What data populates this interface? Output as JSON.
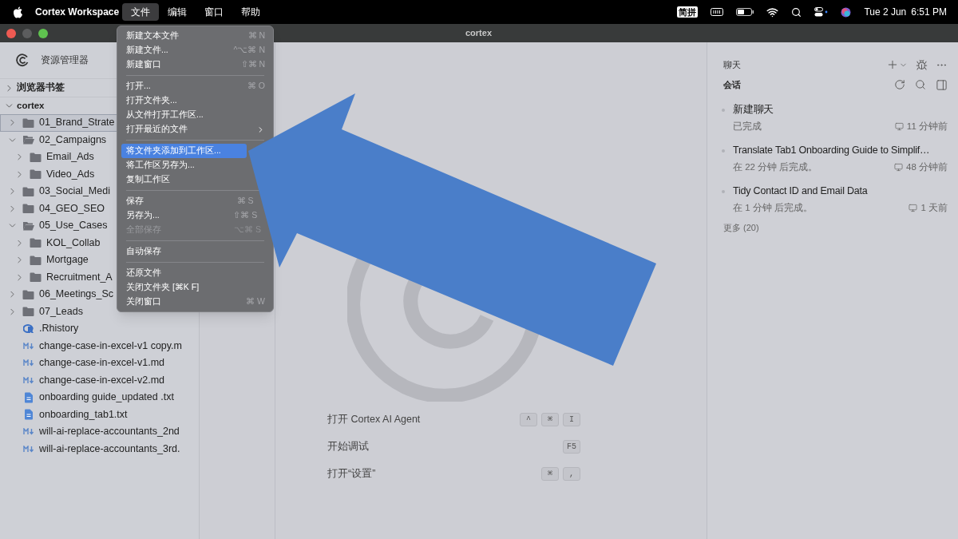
{
  "menubar": {
    "app_name": "Cortex Workspace",
    "menus": [
      {
        "label": "文件",
        "selected": true
      },
      {
        "label": "编辑",
        "selected": false
      },
      {
        "label": "窗口",
        "selected": false
      },
      {
        "label": "帮助",
        "selected": false
      }
    ],
    "input_method": "简拼",
    "date": "Tue 2 Jun",
    "time": "6:51 PM"
  },
  "window": {
    "title": "cortex"
  },
  "explorer": {
    "title": "资源管理器",
    "sections": [
      {
        "label": "浏览器书签",
        "expanded": false
      },
      {
        "label": "cortex",
        "expanded": true,
        "children": [
          {
            "name": "01_Brand_Strate",
            "kind": "folder",
            "expanded": false,
            "selected": true
          },
          {
            "name": "02_Campaigns",
            "kind": "folder",
            "expanded": true,
            "selected": false,
            "children": [
              {
                "name": "Email_Ads",
                "kind": "folder",
                "expanded": false,
                "selected": false
              },
              {
                "name": "Video_Ads",
                "kind": "folder",
                "expanded": false,
                "selected": false
              }
            ]
          },
          {
            "name": "03_Social_Medi",
            "kind": "folder",
            "expanded": false,
            "selected": false
          },
          {
            "name": "04_GEO_SEO",
            "kind": "folder",
            "expanded": false,
            "selected": false
          },
          {
            "name": "05_Use_Cases",
            "kind": "folder",
            "expanded": true,
            "selected": false,
            "children": [
              {
                "name": "KOL_Collab",
                "kind": "folder",
                "expanded": false,
                "selected": false
              },
              {
                "name": "Mortgage",
                "kind": "folder",
                "expanded": false,
                "selected": false
              },
              {
                "name": "Recruitment_A",
                "kind": "folder",
                "expanded": false,
                "selected": false
              }
            ]
          },
          {
            "name": "06_Meetings_Sc",
            "kind": "folder",
            "expanded": false,
            "selected": false
          },
          {
            "name": "07_Leads",
            "kind": "folder",
            "expanded": false,
            "selected": false
          },
          {
            "name": ".Rhistory",
            "kind": "r",
            "selected": false
          },
          {
            "name": "change-case-in-excel-v1 copy.m",
            "kind": "md",
            "selected": false
          },
          {
            "name": "change-case-in-excel-v1.md",
            "kind": "md",
            "selected": false
          },
          {
            "name": "change-case-in-excel-v2.md",
            "kind": "md",
            "selected": false
          },
          {
            "name": "onboarding guide_updated .txt",
            "kind": "txt",
            "selected": false
          },
          {
            "name": "onboarding_tab1.txt",
            "kind": "txt",
            "selected": false
          },
          {
            "name": "will-ai-replace-accountants_2nd",
            "kind": "md",
            "selected": false
          },
          {
            "name": "will-ai-replace-accountants_3rd.",
            "kind": "md",
            "selected": false
          }
        ]
      }
    ]
  },
  "file_menu": {
    "items": [
      {
        "kind": "item",
        "label": "新建文本文件",
        "shortcut": "⌘ N",
        "disabled": false,
        "selected": false
      },
      {
        "kind": "item",
        "label": "新建文件...",
        "shortcut": "^⌥⌘ N",
        "disabled": false,
        "selected": false
      },
      {
        "kind": "item",
        "label": "新建窗口",
        "shortcut": "⇧⌘ N",
        "disabled": false,
        "selected": false
      },
      {
        "kind": "separator"
      },
      {
        "kind": "item",
        "label": "打开...",
        "shortcut": "⌘ O",
        "disabled": false,
        "selected": false
      },
      {
        "kind": "item",
        "label": "打开文件夹...",
        "disabled": false,
        "selected": false
      },
      {
        "kind": "item",
        "label": "从文件打开工作区...",
        "disabled": false,
        "selected": false
      },
      {
        "kind": "item",
        "label": "打开最近的文件",
        "submenu": true,
        "disabled": false,
        "selected": false
      },
      {
        "kind": "separator"
      },
      {
        "kind": "item",
        "label": "将文件夹添加到工作区...",
        "disabled": false,
        "selected": true
      },
      {
        "kind": "item",
        "label": "将工作区另存为...",
        "disabled": false,
        "selected": false
      },
      {
        "kind": "item",
        "label": "复制工作区",
        "disabled": false,
        "selected": false
      },
      {
        "kind": "separator"
      },
      {
        "kind": "item",
        "label": "保存",
        "shortcut": "⌘ S",
        "disabled": false,
        "selected": false
      },
      {
        "kind": "item",
        "label": "另存为...",
        "shortcut": "⇧⌘ S",
        "disabled": false,
        "selected": false
      },
      {
        "kind": "item",
        "label": "全部保存",
        "shortcut": "⌥⌘ S",
        "disabled": true,
        "selected": false
      },
      {
        "kind": "separator"
      },
      {
        "kind": "item",
        "label": "自动保存",
        "disabled": false,
        "selected": false
      },
      {
        "kind": "separator"
      },
      {
        "kind": "item",
        "label": "还原文件",
        "disabled": false,
        "selected": false
      },
      {
        "kind": "item",
        "label": "关闭文件夹 [⌘K F]",
        "disabled": false,
        "selected": false
      },
      {
        "kind": "item",
        "label": "关闭窗口",
        "shortcut": "⌘ W",
        "disabled": false,
        "selected": false
      }
    ]
  },
  "welcome": {
    "shortcuts": [
      {
        "label": "打开 Cortex AI Agent",
        "keys": [
          "^",
          "⌘",
          "I"
        ]
      },
      {
        "label": "开始调试",
        "keys": [
          "F5"
        ]
      },
      {
        "label": "打开“设置”",
        "keys": [
          "⌘",
          ","
        ]
      }
    ]
  },
  "chat": {
    "title": "聊天",
    "sessions_title": "会话",
    "sessions": [
      {
        "title": "新建聊天",
        "status": "已完成",
        "time": "11 分钟前"
      },
      {
        "title": "Translate Tab1 Onboarding Guide to Simplif…",
        "status": "在 22 分钟 后完成。",
        "time": "48 分钟前"
      },
      {
        "title": "Tidy Contact ID and Email Data",
        "status": "在 1 分钟 后完成。",
        "time": "1 天前"
      }
    ],
    "more": "更多 (20)"
  }
}
